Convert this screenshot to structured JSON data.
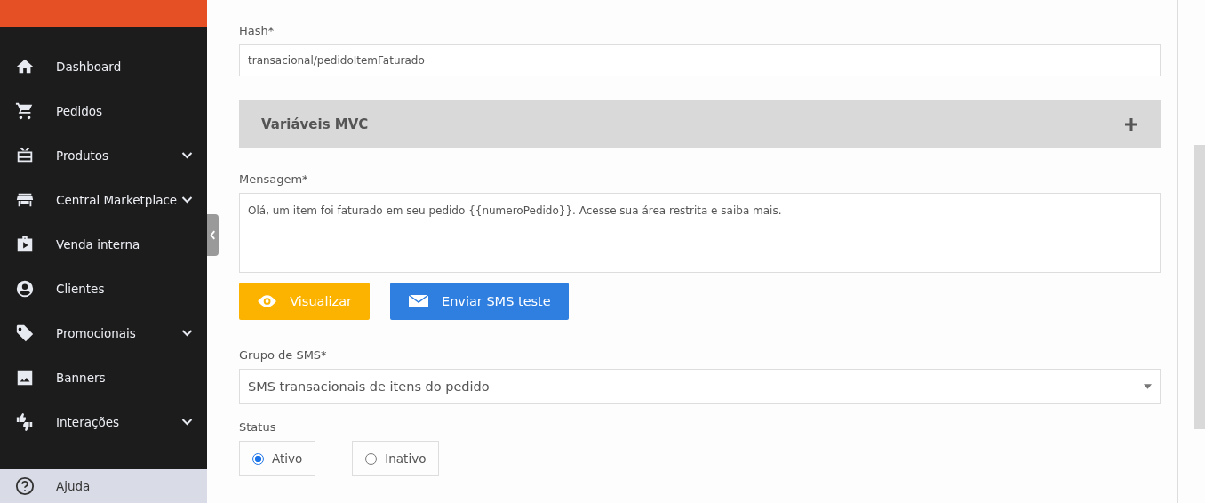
{
  "sidebar": {
    "items": [
      {
        "label": "Dashboard",
        "expandable": false
      },
      {
        "label": "Pedidos",
        "expandable": false
      },
      {
        "label": "Produtos",
        "expandable": true
      },
      {
        "label": "Central Marketplace",
        "expandable": true
      },
      {
        "label": "Venda interna",
        "expandable": false
      },
      {
        "label": "Clientes",
        "expandable": false
      },
      {
        "label": "Promocionais",
        "expandable": true
      },
      {
        "label": "Banners",
        "expandable": false
      },
      {
        "label": "Interações",
        "expandable": true
      }
    ],
    "footer": {
      "label": "Ajuda"
    }
  },
  "form": {
    "hash": {
      "label": "Hash*",
      "value": "transacional/pedidoItemFaturado"
    },
    "panel": {
      "title": "Variáveis MVC",
      "expanded": false
    },
    "message": {
      "label": "Mensagem*",
      "value": "Olá, um item foi faturado em seu pedido {{numeroPedido}}. Acesse sua área restrita e saiba mais."
    },
    "buttons": [
      {
        "label": "Visualizar",
        "kind": "preview"
      },
      {
        "label": "Enviar SMS teste",
        "kind": "send"
      }
    ],
    "group": {
      "label": "Grupo de SMS*",
      "value": "SMS transacionais de itens do pedido"
    },
    "status": {
      "label": "Status",
      "options": [
        {
          "label": "Ativo",
          "selected": true
        },
        {
          "label": "Inativo",
          "selected": false
        }
      ]
    }
  }
}
